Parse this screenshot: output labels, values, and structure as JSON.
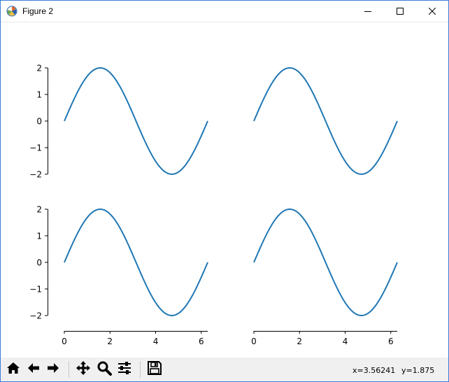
{
  "window": {
    "title": "Figure 2",
    "icon": "matplotlib-icon",
    "controls": [
      "minimize-icon",
      "maximize-icon",
      "close-icon"
    ]
  },
  "toolbar": {
    "buttons": [
      "home-icon",
      "back-icon",
      "forward-icon",
      "pan-icon",
      "zoom-icon",
      "configure-subplots-icon",
      "save-icon"
    ],
    "coords": {
      "x": "x=3.56241",
      "y": "y=1.875"
    }
  },
  "chart_data": [
    {
      "type": "line",
      "position": "top-left",
      "function": "2*sin(x)",
      "xlim": [
        0,
        6.283
      ],
      "ylim": [
        -2,
        2
      ],
      "yticks": [
        "2",
        "1",
        "0",
        "−1",
        "−2"
      ],
      "xticks": [],
      "series": [
        {
          "color": "#1f77b4",
          "x": [
            0,
            0.785,
            1.571,
            2.356,
            3.142,
            3.927,
            4.712,
            5.498,
            6.283
          ],
          "y": [
            0,
            1.414,
            2,
            1.414,
            0,
            -1.414,
            -2,
            -1.414,
            0
          ]
        }
      ]
    },
    {
      "type": "line",
      "position": "top-right",
      "function": "2*sin(x)",
      "xlim": [
        0,
        6.283
      ],
      "ylim": [
        -2,
        2
      ],
      "yticks": [],
      "xticks": [],
      "series": [
        {
          "color": "#1f77b4",
          "x": [
            0,
            0.785,
            1.571,
            2.356,
            3.142,
            3.927,
            4.712,
            5.498,
            6.283
          ],
          "y": [
            0,
            1.414,
            2,
            1.414,
            0,
            -1.414,
            -2,
            -1.414,
            0
          ]
        }
      ]
    },
    {
      "type": "line",
      "position": "bottom-left",
      "function": "2*sin(x)",
      "xlim": [
        0,
        6.283
      ],
      "ylim": [
        -2,
        2
      ],
      "yticks": [
        "2",
        "1",
        "0",
        "−1",
        "−2"
      ],
      "xticks": [
        "0",
        "2",
        "4",
        "6"
      ],
      "series": [
        {
          "color": "#1f77b4",
          "x": [
            0,
            0.785,
            1.571,
            2.356,
            3.142,
            3.927,
            4.712,
            5.498,
            6.283
          ],
          "y": [
            0,
            1.414,
            2,
            1.414,
            0,
            -1.414,
            -2,
            -1.414,
            0
          ]
        }
      ]
    },
    {
      "type": "line",
      "position": "bottom-right",
      "function": "2*sin(x)",
      "xlim": [
        0,
        6.283
      ],
      "ylim": [
        -2,
        2
      ],
      "yticks": [],
      "xticks": [
        "0",
        "2",
        "4",
        "6"
      ],
      "series": [
        {
          "color": "#1f77b4",
          "x": [
            0,
            0.785,
            1.571,
            2.356,
            3.142,
            3.927,
            4.712,
            5.498,
            6.283
          ],
          "y": [
            0,
            1.414,
            2,
            1.414,
            0,
            -1.414,
            -2,
            -1.414,
            0
          ]
        }
      ]
    }
  ]
}
